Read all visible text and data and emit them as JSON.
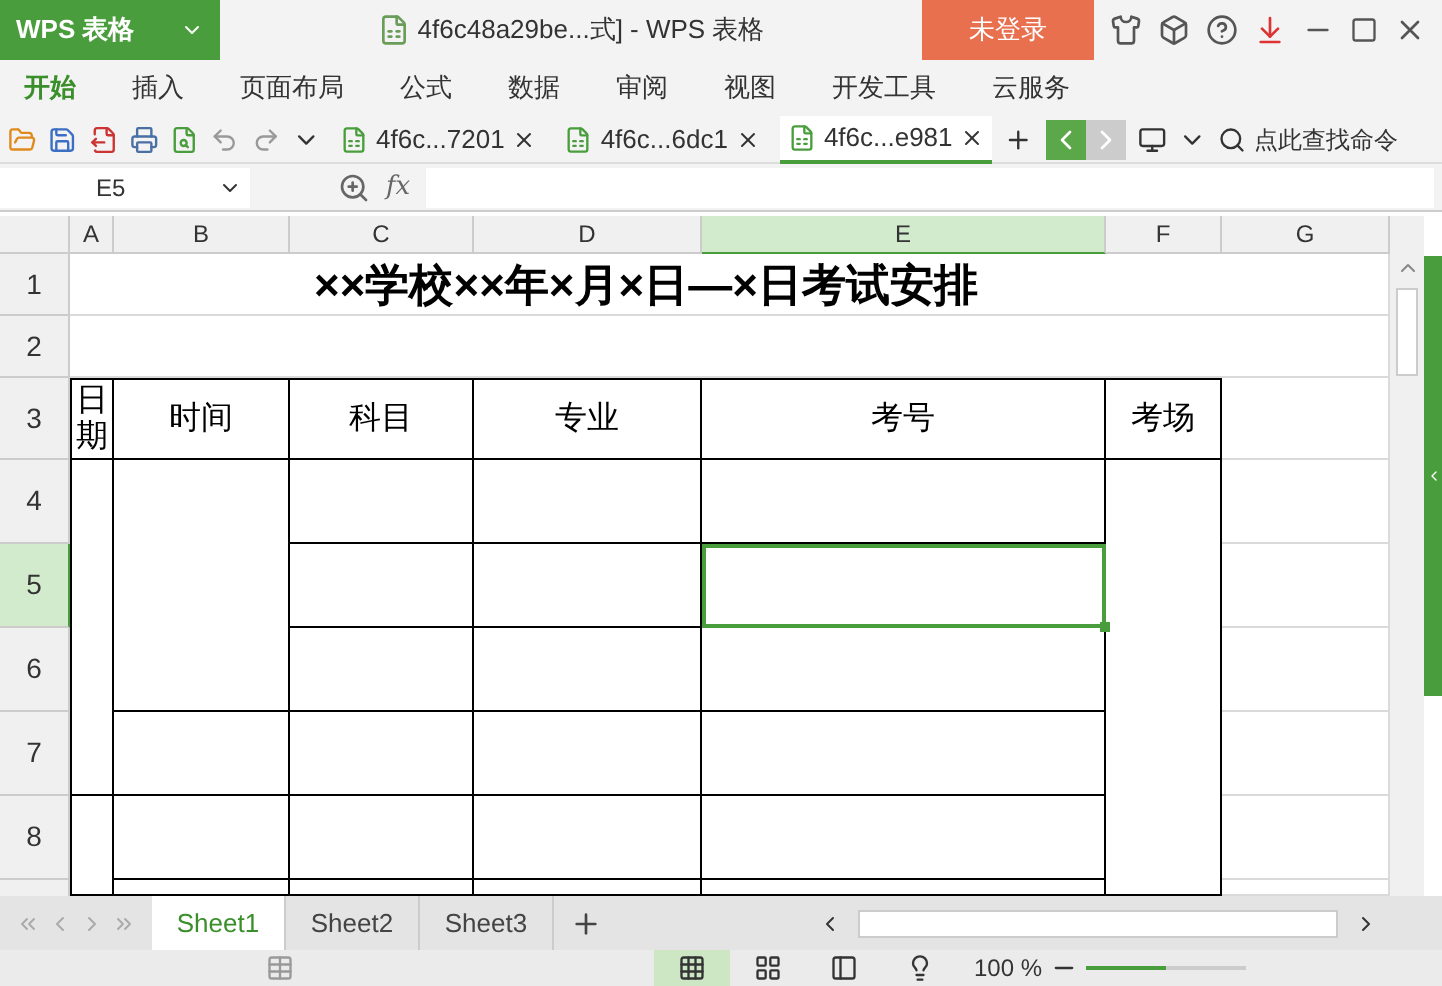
{
  "app_menu": {
    "label": "WPS 表格"
  },
  "window": {
    "title": "4f6c48a29be...式] - WPS 表格"
  },
  "login_button": "未登录",
  "menu": [
    {
      "label": "开始",
      "selected": true
    },
    {
      "label": "插入",
      "selected": false
    },
    {
      "label": "页面布局",
      "selected": false
    },
    {
      "label": "公式",
      "selected": false
    },
    {
      "label": "数据",
      "selected": false
    },
    {
      "label": "审阅",
      "selected": false
    },
    {
      "label": "视图",
      "selected": false
    },
    {
      "label": "开发工具",
      "selected": false
    },
    {
      "label": "云服务",
      "selected": false
    }
  ],
  "documents": [
    {
      "label": "4f6c...7201",
      "selected": false
    },
    {
      "label": "4f6c...6dc1",
      "selected": false
    },
    {
      "label": "4f6c...e981",
      "selected": true
    }
  ],
  "command_search": {
    "placeholder": "点此查找命令"
  },
  "name_box": "E5",
  "fx_label": "fx",
  "columns": [
    {
      "label": "A",
      "selected": false
    },
    {
      "label": "B",
      "selected": false
    },
    {
      "label": "C",
      "selected": false
    },
    {
      "label": "D",
      "selected": false
    },
    {
      "label": "E",
      "selected": true
    },
    {
      "label": "F",
      "selected": false
    },
    {
      "label": "G",
      "selected": false
    }
  ],
  "rows": [
    {
      "label": "1",
      "selected": false
    },
    {
      "label": "2",
      "selected": false
    },
    {
      "label": "3",
      "selected": false
    },
    {
      "label": "4",
      "selected": false
    },
    {
      "label": "5",
      "selected": true
    },
    {
      "label": "6",
      "selected": false
    },
    {
      "label": "7",
      "selected": false
    },
    {
      "label": "8",
      "selected": false
    }
  ],
  "title": "××学校××年×月×日—×日考试安排",
  "headers": [
    {
      "text": "日期",
      "kind": "vertical"
    },
    {
      "text": "时间",
      "kind": "normal"
    },
    {
      "text": "科目",
      "kind": "normal"
    },
    {
      "text": "专业",
      "kind": "normal"
    },
    {
      "text": "考号",
      "kind": "normal"
    },
    {
      "text": "考场",
      "kind": "normal"
    }
  ],
  "sheets": [
    {
      "label": "Sheet1",
      "selected": true
    },
    {
      "label": "Sheet2",
      "selected": false
    },
    {
      "label": "Sheet3",
      "selected": false
    }
  ],
  "zoom": "100 %",
  "zoom_slider": {
    "level": 0.5
  }
}
